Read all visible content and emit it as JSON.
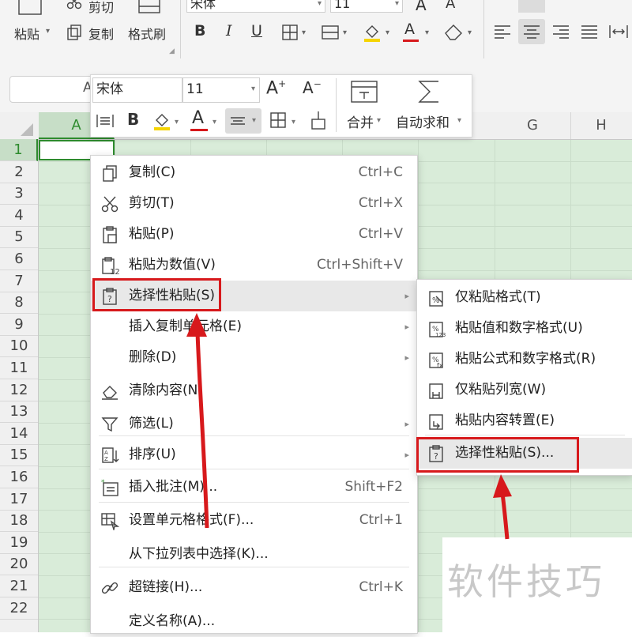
{
  "ribbon": {
    "font_name": "宋体",
    "font_size": "11",
    "paste": "粘贴",
    "cut": "剪切",
    "copy": "复制",
    "format_painter": "格式刷"
  },
  "mini_toolbar": {
    "font_name": "宋体",
    "font_size": "11",
    "bold": "B",
    "merge": "合并",
    "autosum": "自动求和"
  },
  "namebox_value": "A",
  "columns": [
    "A",
    "G",
    "H"
  ],
  "rows": [
    "1",
    "2",
    "3",
    "4",
    "5",
    "6",
    "7",
    "8",
    "9",
    "10",
    "11",
    "12",
    "13",
    "14",
    "15",
    "16",
    "17",
    "18",
    "19",
    "20",
    "21",
    "22"
  ],
  "context_menu": [
    {
      "label": "复制(C)",
      "shortcut": "Ctrl+C",
      "icon": "copy-icon"
    },
    {
      "label": "剪切(T)",
      "shortcut": "Ctrl+X",
      "icon": "scissors-icon"
    },
    {
      "label": "粘贴(P)",
      "shortcut": "Ctrl+V",
      "icon": "paste-icon"
    },
    {
      "label": "粘贴为数值(V)",
      "shortcut": "Ctrl+Shift+V",
      "icon": "paste-values-icon"
    },
    {
      "label": "选择性粘贴(S)",
      "shortcut": "",
      "icon": "paste-special-icon",
      "submenu": true
    },
    {
      "label": "插入复制单元格(E)",
      "shortcut": "",
      "icon": "",
      "submenu": true
    },
    {
      "label": "删除(D)",
      "shortcut": "",
      "icon": "",
      "submenu": true
    },
    {
      "label": "清除内容(N)",
      "shortcut": "",
      "icon": "eraser-icon"
    },
    {
      "label": "筛选(L)",
      "shortcut": "",
      "icon": "filter-icon",
      "submenu": true
    },
    {
      "label": "排序(U)",
      "shortcut": "",
      "icon": "sort-icon",
      "submenu": true
    },
    {
      "label": "插入批注(M)...",
      "shortcut": "Shift+F2",
      "icon": "comment-icon"
    },
    {
      "label": "设置单元格格式(F)...",
      "shortcut": "Ctrl+1",
      "icon": "format-cells-icon"
    },
    {
      "label": "从下拉列表中选择(K)...",
      "shortcut": "",
      "icon": ""
    },
    {
      "label": "超链接(H)...",
      "shortcut": "Ctrl+K",
      "icon": "link-icon"
    },
    {
      "label": "定义名称(A)...",
      "shortcut": "",
      "icon": ""
    }
  ],
  "submenu": [
    {
      "label": "仅粘贴格式(T)",
      "icon": "paste-format-icon"
    },
    {
      "label": "粘贴值和数字格式(U)",
      "icon": "paste-value-number-icon"
    },
    {
      "label": "粘贴公式和数字格式(R)",
      "icon": "paste-formula-icon"
    },
    {
      "label": "仅粘贴列宽(W)",
      "icon": "paste-colwidth-icon"
    },
    {
      "label": "粘贴内容转置(E)",
      "icon": "transpose-icon"
    },
    {
      "label": "选择性粘贴(S)...",
      "icon": "paste-special-icon"
    }
  ],
  "watermark": "软件技巧",
  "colors": {
    "highlight_red": "#d7191c",
    "grid_green": "#d9ecd9",
    "select_green": "#2e8b2e"
  }
}
